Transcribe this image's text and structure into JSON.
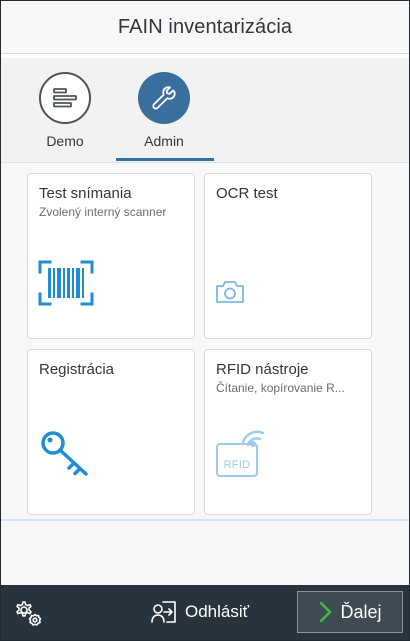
{
  "header": {
    "title": "FAIN inventarizácia"
  },
  "tabs": [
    {
      "label": "Demo",
      "icon": "list-icon"
    },
    {
      "label": "Admin",
      "icon": "wrench-icon"
    }
  ],
  "tiles": [
    {
      "title": "Test snímania",
      "subtitle": "Zvolený interný scanner",
      "icon": "barcode-scan-icon"
    },
    {
      "title": "OCR test",
      "subtitle": "",
      "icon": "camera-icon"
    },
    {
      "title": "Registrácia",
      "subtitle": "",
      "icon": "key-icon"
    },
    {
      "title": "RFID nástroje",
      "subtitle": "Čítanie, kopírovanie R...",
      "icon": "rfid-icon",
      "icon_text": "RFID"
    }
  ],
  "footer": {
    "settings_icon": "gear-icon",
    "logout_label": "Odhlásiť",
    "next_label": "Ďalej"
  },
  "colors": {
    "accent": "#3a6e9c",
    "icon_blue": "#1f8dd6",
    "footer_bg": "#29333d"
  }
}
